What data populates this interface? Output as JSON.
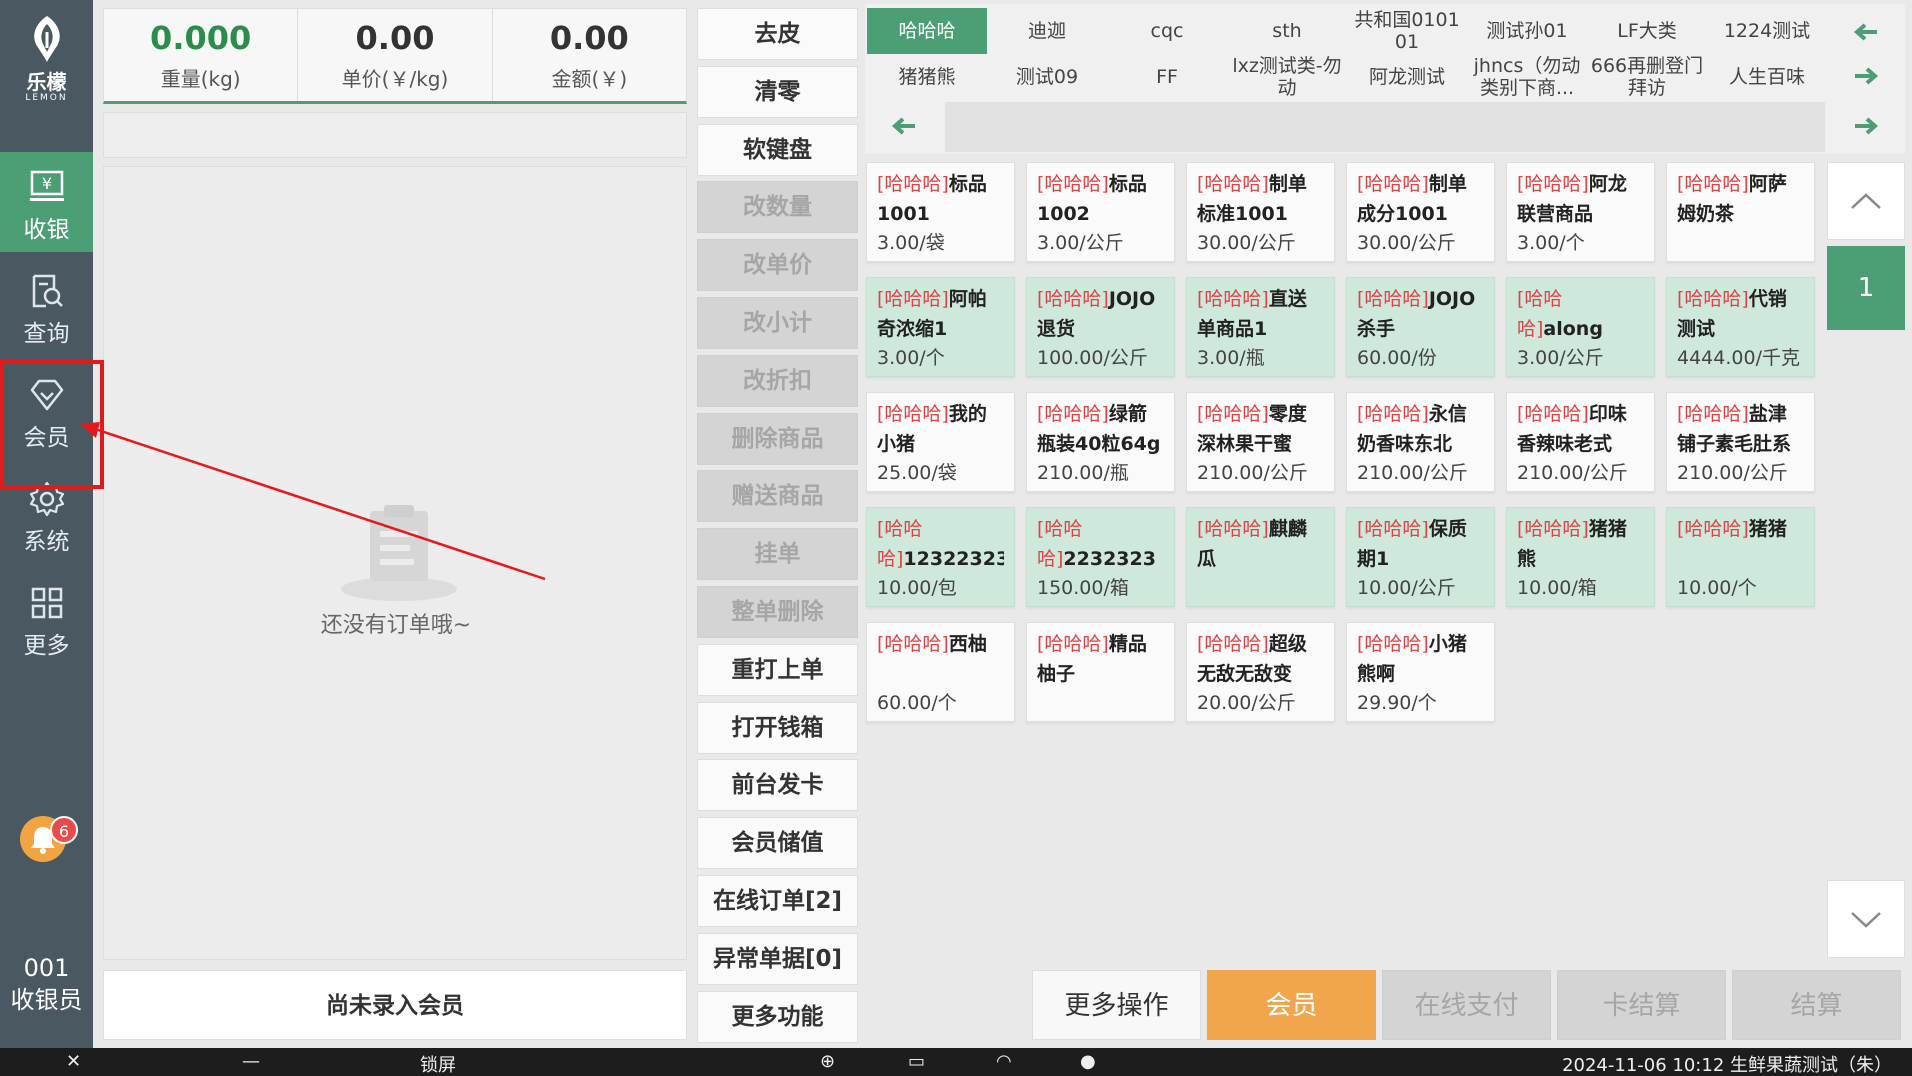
{
  "app": {
    "logo_cn": "乐檬",
    "logo_en": "LEMON"
  },
  "sidebar": {
    "items": [
      {
        "label": "收银",
        "icon": "cashier-icon",
        "active": true
      },
      {
        "label": "查询",
        "icon": "search-doc-icon",
        "active": false
      },
      {
        "label": "会员",
        "icon": "diamond-icon",
        "active": false
      },
      {
        "label": "系统",
        "icon": "gear-icon",
        "active": false
      },
      {
        "label": "更多",
        "icon": "grid-icon",
        "active": false
      }
    ],
    "notification_count": "6",
    "cashier_id": "001",
    "cashier_role": "收银员"
  },
  "scale": {
    "weight_value": "0.000",
    "weight_label": "重量(kg)",
    "unit_price_value": "0.00",
    "unit_price_label": "单价(￥/kg)",
    "amount_value": "0.00",
    "amount_label": "金额(￥)"
  },
  "order": {
    "empty_text": "还没有订单哦~",
    "member_status": "尚未录入会员"
  },
  "operations": [
    {
      "label": "去皮",
      "enabled": true
    },
    {
      "label": "清零",
      "enabled": true
    },
    {
      "label": "软键盘",
      "enabled": true
    },
    {
      "label": "改数量",
      "enabled": false
    },
    {
      "label": "改单价",
      "enabled": false
    },
    {
      "label": "改小计",
      "enabled": false
    },
    {
      "label": "改折扣",
      "enabled": false
    },
    {
      "label": "删除商品",
      "enabled": false
    },
    {
      "label": "赠送商品",
      "enabled": false
    },
    {
      "label": "挂单",
      "enabled": false
    },
    {
      "label": "整单删除",
      "enabled": false
    },
    {
      "label": "重打上单",
      "enabled": true
    },
    {
      "label": "打开钱箱",
      "enabled": true
    },
    {
      "label": "前台发卡",
      "enabled": true
    },
    {
      "label": "会员储值",
      "enabled": true
    },
    {
      "label": "在线订单[2]",
      "enabled": true
    },
    {
      "label": "异常单据[0]",
      "enabled": true
    },
    {
      "label": "更多功能",
      "enabled": true
    }
  ],
  "categories": {
    "row1": [
      "哈哈哈",
      "迪迦",
      "cqc",
      "sth",
      "共和国0101 01",
      "测试孙01",
      "LF大类",
      "1224测试"
    ],
    "row2": [
      "猪猪熊",
      "测试09",
      "FF",
      "lxz测试类-勿动",
      "阿龙测试",
      "jhncs（勿动类别下商...",
      "666再删登门拜访",
      "人生百味"
    ],
    "active": "哈哈哈"
  },
  "products": [
    {
      "tag": "[哈哈哈]",
      "name": "标品1001",
      "price": "3.00/袋",
      "green": false
    },
    {
      "tag": "[哈哈哈]",
      "name": "标品1002",
      "price": "3.00/公斤",
      "green": false
    },
    {
      "tag": "[哈哈哈]",
      "name": "制单标准1001",
      "price": "30.00/公斤",
      "green": false
    },
    {
      "tag": "[哈哈哈]",
      "name": "制单成分1001",
      "price": "30.00/公斤",
      "green": false
    },
    {
      "tag": "[哈哈哈]",
      "name": "阿龙联营商品",
      "price": "3.00/个",
      "green": false
    },
    {
      "tag": "[哈哈哈]",
      "name": "阿萨姆奶茶",
      "price": "",
      "green": false
    },
    {
      "tag": "[哈哈哈]",
      "name": "阿帕奇浓缩1",
      "price": "3.00/个",
      "green": true
    },
    {
      "tag": "[哈哈哈]",
      "name": "JOJO退货",
      "price": "100.00/公斤",
      "green": true
    },
    {
      "tag": "[哈哈哈]",
      "name": "直送单商品1",
      "price": "3.00/瓶",
      "green": true
    },
    {
      "tag": "[哈哈哈]",
      "name": "JOJO杀手",
      "price": "60.00/份",
      "green": true
    },
    {
      "tag": "[哈哈哈]",
      "name": "along",
      "price": "3.00/公斤",
      "green": true
    },
    {
      "tag": "[哈哈哈]",
      "name": "代销测试",
      "price": "4444.00/千克",
      "green": true
    },
    {
      "tag": "[哈哈哈]",
      "name": "我的小猪",
      "price": "25.00/袋",
      "green": false
    },
    {
      "tag": "[哈哈哈]",
      "name": "绿箭瓶装40粒64g",
      "price": "210.00/瓶",
      "green": false
    },
    {
      "tag": "[哈哈哈]",
      "name": "零度深林果干蜜饯...",
      "price": "210.00/公斤",
      "green": false
    },
    {
      "tag": "[哈哈哈]",
      "name": "永信奶香味东北小...",
      "price": "210.00/公斤",
      "green": false
    },
    {
      "tag": "[哈哈哈]",
      "name": "印味香辣味老式长...",
      "price": "210.00/公斤",
      "green": false
    },
    {
      "tag": "[哈哈哈]",
      "name": "盐津铺子素毛肚系列",
      "price": "210.00/公斤",
      "green": false
    },
    {
      "tag": "[哈哈哈]",
      "name": "12322323",
      "price": "10.00/包",
      "green": true
    },
    {
      "tag": "[哈哈哈]",
      "name": "2232323",
      "price": "150.00/箱",
      "green": true
    },
    {
      "tag": "[哈哈哈]",
      "name": "麒麟瓜",
      "price": "",
      "green": true
    },
    {
      "tag": "[哈哈哈]",
      "name": "保质期1",
      "price": "10.00/公斤",
      "green": true
    },
    {
      "tag": "[哈哈哈]",
      "name": "猪猪熊",
      "price": "10.00/箱",
      "green": true
    },
    {
      "tag": "[哈哈哈]",
      "name": "猪猪",
      "price": "10.00/个",
      "green": true
    },
    {
      "tag": "[哈哈哈]",
      "name": "西柚",
      "price": "60.00/个",
      "green": false
    },
    {
      "tag": "[哈哈哈]",
      "name": "精品柚子",
      "price": "",
      "green": false
    },
    {
      "tag": "[哈哈哈]",
      "name": "超级无敌无敌变态...",
      "price": "20.00/公斤",
      "green": false
    },
    {
      "tag": "[哈哈哈]",
      "name": "小猪熊啊",
      "price": "29.90/个",
      "green": false
    }
  ],
  "pagination": {
    "current_page": "1"
  },
  "actions": {
    "more_ops": "更多操作",
    "member": "会员",
    "online_pay": "在线支付",
    "card_settle": "卡结算",
    "settle": "结算"
  },
  "taskbar": {
    "lock_label": "锁屏",
    "status_text": "2024-11-06 10:12 生鲜果蔬测试（朱）"
  },
  "colors": {
    "sidebar_bg": "#4a5862",
    "accent_green": "#4c9e75",
    "member_orange": "#f2a64c",
    "tag_red": "#e04343",
    "annotation_red": "#e41a1a"
  }
}
